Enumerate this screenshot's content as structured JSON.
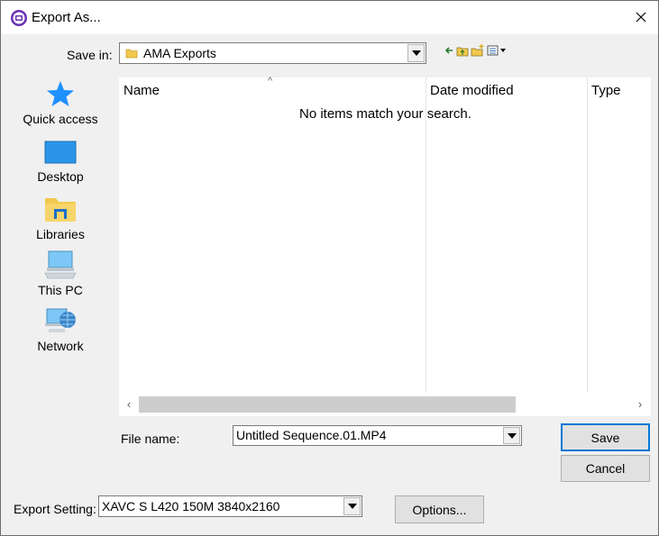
{
  "window": {
    "title": "Export As...",
    "close_glyph": "✕",
    "app_icon": "app-logo-icon"
  },
  "toolbar": {
    "save_in_label": "Save in:",
    "save_in_value": "AMA Exports"
  },
  "places": [
    {
      "label": "Quick access",
      "icon": "star-icon"
    },
    {
      "label": "Desktop",
      "icon": "desktop-icon"
    },
    {
      "label": "Libraries",
      "icon": "libraries-icon"
    },
    {
      "label": "This PC",
      "icon": "computer-icon"
    },
    {
      "label": "Network",
      "icon": "network-icon"
    }
  ],
  "file_list": {
    "columns": [
      "Name",
      "Date modified",
      "Type"
    ],
    "sort_glyph": "^",
    "empty_message": "No items match your search."
  },
  "scroll": {
    "left": "‹",
    "right": "›"
  },
  "file_name": {
    "label": "File name:",
    "value": "Untitled Sequence.01.MP4"
  },
  "buttons": {
    "save": "Save",
    "cancel": "Cancel",
    "options": "Options..."
  },
  "export_setting": {
    "label": "Export Setting:",
    "value": "XAVC S L420 150M 3840x2160"
  },
  "colors": {
    "accent": "#0078d7",
    "folder": "#f2c94c",
    "star": "#1e90ff"
  }
}
